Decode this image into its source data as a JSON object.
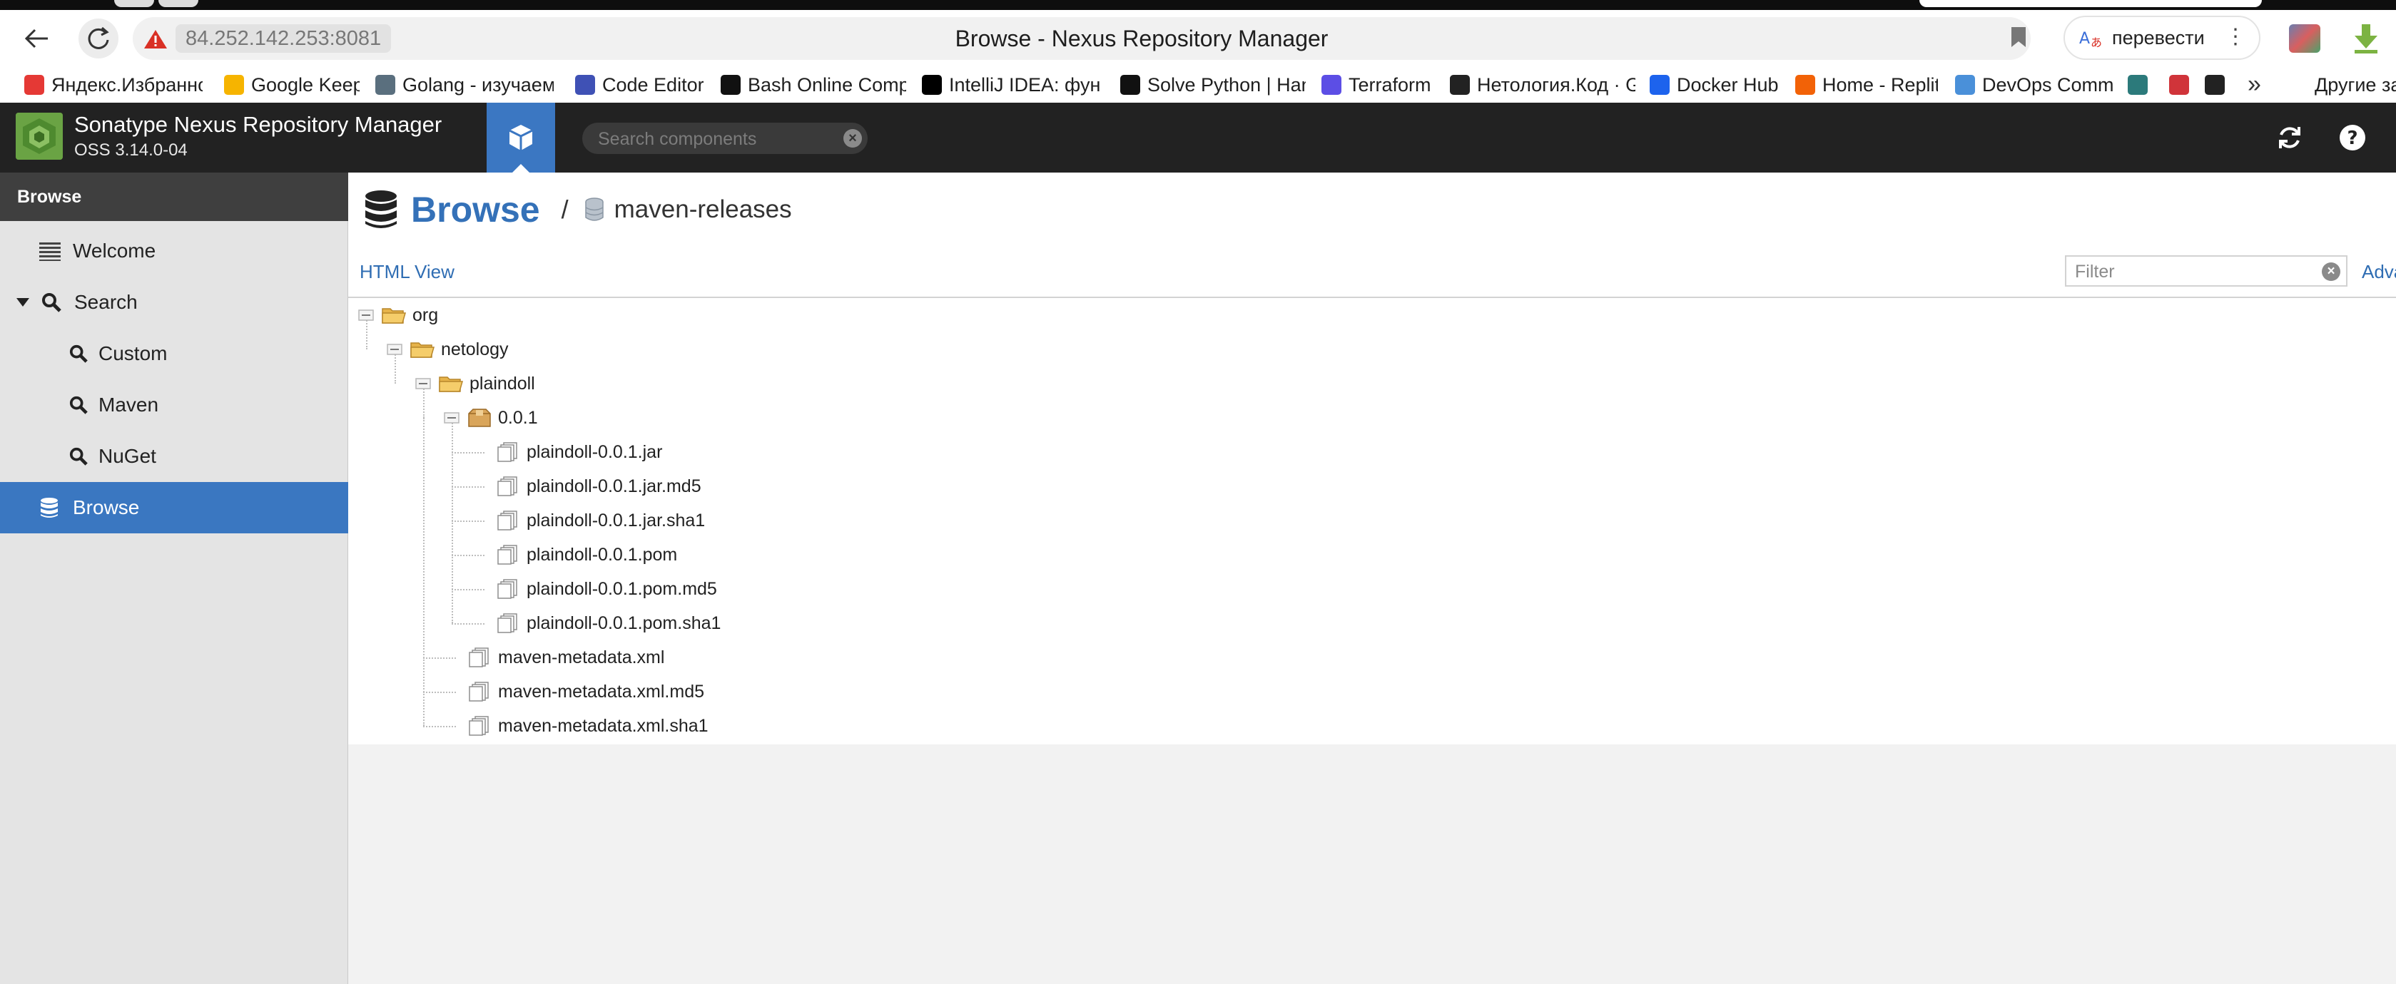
{
  "browser": {
    "url_host": "84.252.142.253:8081",
    "page_title": "Browse - Nexus Repository Manager",
    "translate_label": "перевести",
    "bookmarks": [
      {
        "label": "Яндекс.Избранное",
        "icon": "yandex-icon",
        "color": "#e53935"
      },
      {
        "label": "Google Keep",
        "icon": "google-keep-icon",
        "color": "#f6b400"
      },
      {
        "label": "Golang - изучаем",
        "icon": "golang-icon",
        "color": "#5a6f7e"
      },
      {
        "label": "Code Editor",
        "icon": "code-editor-icon",
        "color": "#3f51b5"
      },
      {
        "label": "Bash Online Comp",
        "icon": "bash-icon",
        "color": "#111111"
      },
      {
        "label": "IntelliJ IDEA: функ",
        "icon": "intellij-icon",
        "color": "#000000"
      },
      {
        "label": "Solve Python | Han",
        "icon": "hackerrank-icon",
        "color": "#111111"
      },
      {
        "label": "Terraform",
        "icon": "terraform-icon",
        "color": "#5c4ee5"
      },
      {
        "label": "Нетология.Код · G",
        "icon": "github-icon",
        "color": "#222222"
      },
      {
        "label": "Docker Hub",
        "icon": "docker-icon",
        "color": "#1d63ed"
      },
      {
        "label": "Home - Replit",
        "icon": "replit-icon",
        "color": "#f26207"
      },
      {
        "label": "DevOps Comm",
        "icon": "devops-icon",
        "color": "#4a90d9"
      }
    ],
    "more_bookmarks_label": "Другие за"
  },
  "app": {
    "name": "Sonatype Nexus Repository Manager",
    "version": "OSS 3.14.0-04",
    "search_placeholder": "Search components",
    "accent_color": "#3a77c1"
  },
  "sidebar": {
    "heading": "Browse",
    "items": [
      {
        "label": "Welcome",
        "icon": "list-icon"
      },
      {
        "label": "Search",
        "icon": "search-icon"
      },
      {
        "label": "Custom",
        "icon": "search-icon"
      },
      {
        "label": "Maven",
        "icon": "search-icon"
      },
      {
        "label": "NuGet",
        "icon": "search-icon"
      },
      {
        "label": "Browse",
        "icon": "database-icon",
        "selected": true
      }
    ]
  },
  "main": {
    "breadcrumb_root": "Browse",
    "breadcrumb_separator": "/",
    "repository": "maven-releases",
    "html_view_label": "HTML View",
    "filter_placeholder": "Filter",
    "advanced_label": "Adva"
  },
  "tree": [
    {
      "label": "org",
      "type": "folder"
    },
    {
      "label": "netology",
      "type": "folder"
    },
    {
      "label": "plaindoll",
      "type": "folder"
    },
    {
      "label": "0.0.1",
      "type": "version"
    },
    {
      "label": "plaindoll-0.0.1.jar",
      "type": "file"
    },
    {
      "label": "plaindoll-0.0.1.jar.md5",
      "type": "file"
    },
    {
      "label": "plaindoll-0.0.1.jar.sha1",
      "type": "file"
    },
    {
      "label": "plaindoll-0.0.1.pom",
      "type": "file"
    },
    {
      "label": "plaindoll-0.0.1.pom.md5",
      "type": "file"
    },
    {
      "label": "plaindoll-0.0.1.pom.sha1",
      "type": "file"
    },
    {
      "label": "maven-metadata.xml",
      "type": "file"
    },
    {
      "label": "maven-metadata.xml.md5",
      "type": "file"
    },
    {
      "label": "maven-metadata.xml.sha1",
      "type": "file"
    }
  ]
}
